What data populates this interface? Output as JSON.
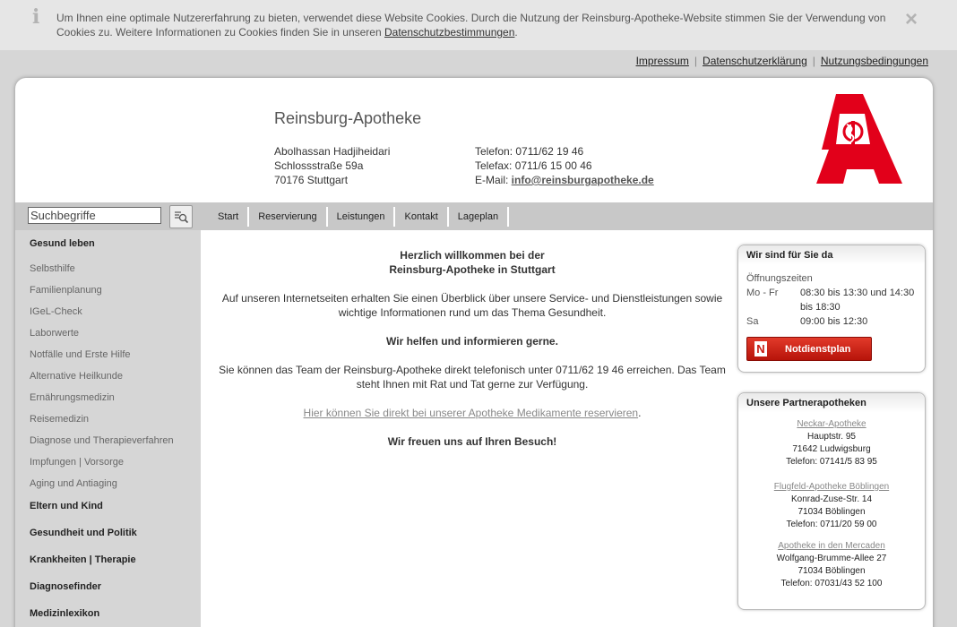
{
  "cookie": {
    "text": "Um Ihnen eine optimale Nutzererfahrung zu bieten, verwendet diese Website Cookies. Durch die Nutzung der Reinsburg-Apotheke-Website stimmen Sie der Verwendung von Cookies zu. Weitere Informationen zu Cookies finden Sie in unseren ",
    "link": "Datenschutzbestimmungen",
    "end": ".",
    "info_icon": "i",
    "close_icon": "×"
  },
  "toplinks": [
    "Impressum",
    "Datenschutzerklärung",
    "Nutzungsbedingungen"
  ],
  "header": {
    "name": "Reinsburg-Apotheke",
    "owner": "Abolhassan Hadjiheidari",
    "street": "Schlossstraße 59a",
    "city": "70176 Stuttgart",
    "phone": "Telefon: 0711/62 19 46",
    "fax": "Telefax: 0711/6 15 00 46",
    "email_label": "E-Mail: ",
    "email": "info@reinsburgapotheke.de",
    "logo_color": "#e2001a"
  },
  "search": {
    "value": "Suchbegriffe"
  },
  "nav": [
    "Start",
    "Reservierung",
    "Leistungen",
    "Kontakt",
    "Lageplan"
  ],
  "sidebar": {
    "gesund_leben": "Gesund leben",
    "subs": [
      "Selbsthilfe",
      "Familienplanung",
      "IGeL-Check",
      "Laborwerte",
      "Notfälle und Erste Hilfe",
      "Alternative Heilkunde",
      "Ernährungsmedizin",
      "Reisemedizin",
      "Diagnose und Therapieverfahren",
      "Impfungen | Vorsorge",
      "Aging und Antiaging"
    ],
    "heads": [
      "Eltern und Kind",
      "Gesundheit und Politik",
      "Krankheiten | Therapie",
      "Diagnosefinder",
      "Medizinlexikon"
    ]
  },
  "content": {
    "welcome1": "Herzlich willkommen bei der",
    "welcome2": "Reinsburg-Apotheke in Stuttgart",
    "intro": "Auf unseren Internetseiten erhalten Sie einen Überblick über unsere Service- und Dienstleistungen sowie wichtige Informationen rund um das Thema Gesundheit.",
    "help": "Wir helfen und informieren gerne.",
    "phone_text": "Sie können das Team der Reinsburg-Apotheke direkt telefonisch unter 0711/62 19 46 erreichen. Das Team steht Ihnen mit Rat und Tat gerne zur Verfügung.",
    "reserve_link": "Hier können Sie direkt bei unserer Apotheke Medikamente reservieren",
    "reserve_end": ".",
    "visit": "Wir freuen uns auf Ihren Besuch!"
  },
  "hoursbox": {
    "title": "Wir sind für Sie da",
    "label": "Öffnungszeiten",
    "rows": [
      {
        "day": "Mo - Fr",
        "time": "08:30 bis 13:30 und 14:30 bis 18:30"
      },
      {
        "day": "Sa",
        "time": "09:00 bis 12:30"
      }
    ],
    "notdienst": "Notdienstplan",
    "notdienst_n": "N"
  },
  "partners": {
    "title": "Unsere Partnerapotheken",
    "items": [
      {
        "name": "Neckar-Apotheke",
        "street": "Hauptstr. 95",
        "city": "71642 Ludwigsburg",
        "phone": "Telefon: 07141/5 83 95"
      },
      {
        "name": "Flugfeld-Apotheke Böblingen",
        "street": "Konrad-Zuse-Str. 14",
        "city": "71034 Böblingen",
        "phone": "Telefon: 0711/20 59 00"
      },
      {
        "name": "Apotheke in den Mercaden",
        "street": "Wolfgang-Brumme-Allee 27",
        "city": "71034 Böblingen",
        "phone": "Telefon: 07031/43 52 100"
      }
    ]
  }
}
